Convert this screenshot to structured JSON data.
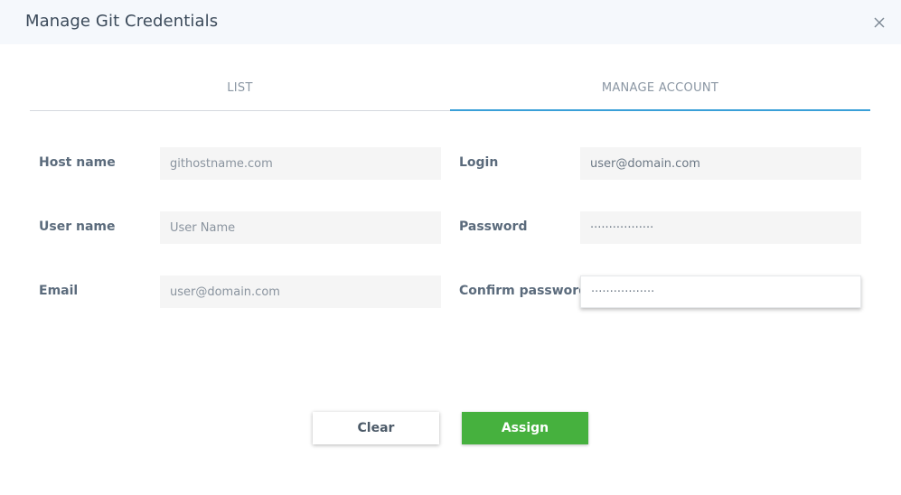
{
  "dialog": {
    "title": "Manage Git Credentials"
  },
  "tabs": [
    {
      "label": "LIST"
    },
    {
      "label": "MANAGE ACCOUNT"
    }
  ],
  "form": {
    "host_name": {
      "label": "Host name",
      "value": "",
      "placeholder": "githostname.com"
    },
    "user_name": {
      "label": "User name",
      "value": "",
      "placeholder": "User Name"
    },
    "email": {
      "label": "Email",
      "value": "",
      "placeholder": "user@domain.com"
    },
    "login": {
      "label": "Login",
      "value": "user@domain.com",
      "placeholder": ""
    },
    "password": {
      "label": "Password",
      "value": "·················",
      "placeholder": ""
    },
    "confirm_password": {
      "label": "Confirm password",
      "value": "·················",
      "placeholder": ""
    }
  },
  "buttons": {
    "clear": "Clear",
    "assign": "Assign"
  },
  "colors": {
    "accent_tab": "#3aa0d8",
    "assign_button": "#46b13e",
    "header_bg": "#f5f8fc"
  },
  "icons": {
    "close": "close-icon"
  }
}
